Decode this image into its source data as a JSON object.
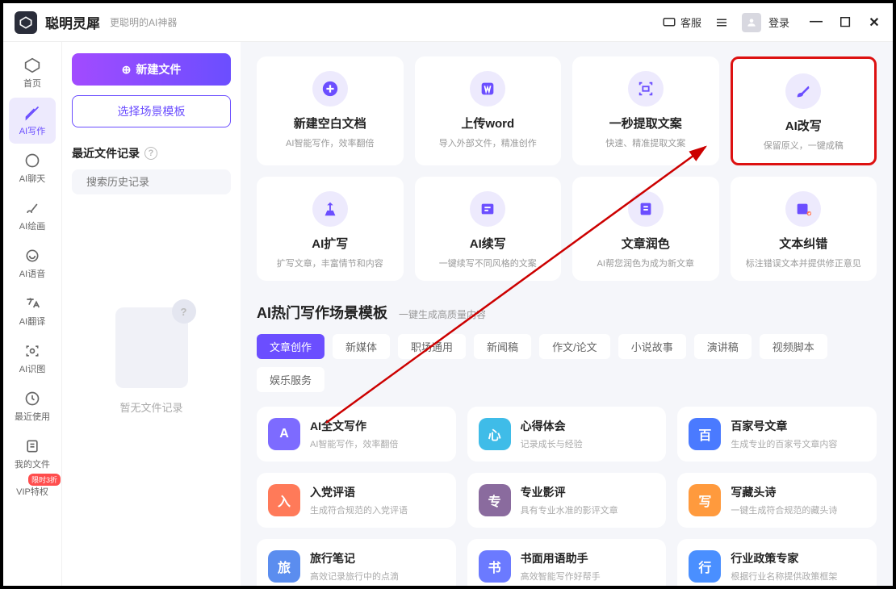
{
  "header": {
    "app_name": "聪明灵犀",
    "tagline": "更聪明的AI神器",
    "support": "客服",
    "login": "登录"
  },
  "sidebar": {
    "items": [
      {
        "label": "首页"
      },
      {
        "label": "AI写作"
      },
      {
        "label": "AI聊天"
      },
      {
        "label": "AI绘画"
      },
      {
        "label": "AI语音"
      },
      {
        "label": "AI翻译"
      },
      {
        "label": "AI识图"
      },
      {
        "label": "最近使用"
      },
      {
        "label": "我的文件"
      },
      {
        "label": "VIP特权",
        "badge": "限时3折"
      }
    ]
  },
  "sec": {
    "new_file": "新建文件",
    "select_template": "选择场景模板",
    "recent_label": "最近文件记录",
    "search_placeholder": "搜索历史记录",
    "empty": "暂无文件记录"
  },
  "cards": [
    {
      "title": "新建空白文档",
      "desc": "AI智能写作，效率翻倍"
    },
    {
      "title": "上传word",
      "desc": "导入外部文件，精准创作"
    },
    {
      "title": "一秒提取文案",
      "desc": "快速、精准提取文案"
    },
    {
      "title": "AI改写",
      "desc": "保留原义，一键成稿"
    },
    {
      "title": "AI扩写",
      "desc": "扩写文章，丰富情节和内容"
    },
    {
      "title": "AI续写",
      "desc": "一键续写不同风格的文案"
    },
    {
      "title": "文章润色",
      "desc": "AI帮您润色为成为新文章"
    },
    {
      "title": "文本纠错",
      "desc": "标注错误文本并提供修正意见"
    }
  ],
  "section": {
    "title": "AI热门写作场景模板",
    "sub": "一键生成高质量内容"
  },
  "tabs": [
    "文章创作",
    "新媒体",
    "职场通用",
    "新闻稿",
    "作文/论文",
    "小说故事",
    "演讲稿",
    "视频脚本",
    "娱乐服务"
  ],
  "templates": [
    {
      "title": "AI全文写作",
      "desc": "AI智能写作，效率翻倍",
      "color": "#7d6bff"
    },
    {
      "title": "心得体会",
      "desc": "记录成长与经验",
      "color": "#3fbce8"
    },
    {
      "title": "百家号文章",
      "desc": "生成专业的百家号文章内容",
      "color": "#4a7aff"
    },
    {
      "title": "入党评语",
      "desc": "生成符合规范的入党评语",
      "color": "#ff7a59"
    },
    {
      "title": "专业影评",
      "desc": "具有专业水准的影评文章",
      "color": "#8a6b9e"
    },
    {
      "title": "写藏头诗",
      "desc": "一键生成符合规范的藏头诗",
      "color": "#ff9a3d"
    },
    {
      "title": "旅行笔记",
      "desc": "高效记录旅行中的点滴",
      "color": "#5b8def"
    },
    {
      "title": "书面用语助手",
      "desc": "高效智能写作好帮手",
      "color": "#6b7aff"
    },
    {
      "title": "行业政策专家",
      "desc": "根据行业名称提供政策框架",
      "color": "#4a8fff"
    }
  ]
}
